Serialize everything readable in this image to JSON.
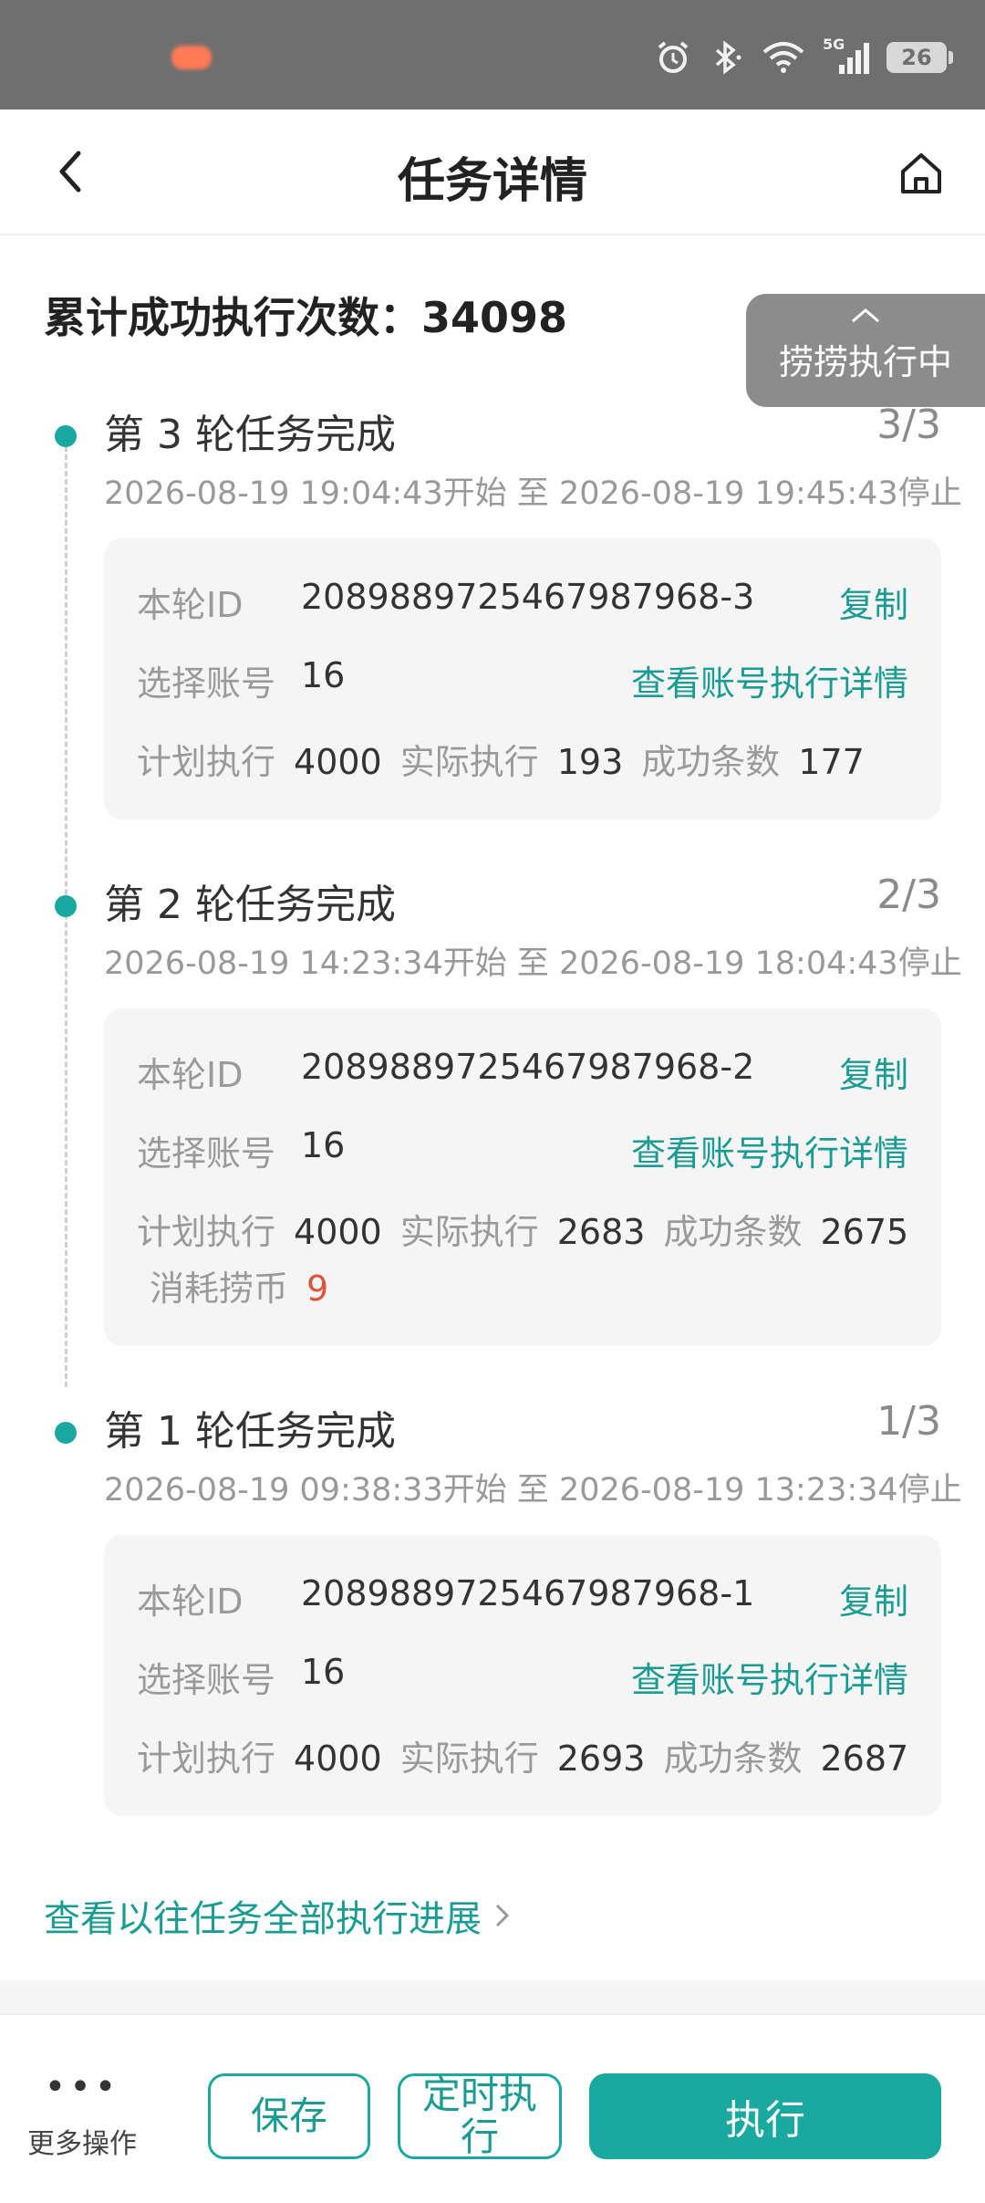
{
  "status_bar": {
    "network": "5G",
    "battery": "26",
    "icons": [
      "alarm-icon",
      "bluetooth-icon",
      "wifi-icon",
      "signal-icon",
      "battery-icon"
    ]
  },
  "header": {
    "title": "任务详情",
    "icons": [
      "back-arrow-icon",
      "home-icon"
    ]
  },
  "summary": {
    "text": "累计成功执行次数：34098"
  },
  "float_tag": {
    "text": "捞捞执行中"
  },
  "labels": {
    "round_id": "本轮ID",
    "account": "选择账号",
    "copy": "复制",
    "account_detail": "查看账号执行详情",
    "planned": "计划执行",
    "actual": "实际执行",
    "success": "成功条数",
    "cost": "消耗捞币"
  },
  "rounds": [
    {
      "title": "第 3 轮任务完成",
      "progress": "3/3",
      "time": "2026-08-19 19:04:43开始 至 2026-08-19 19:45:43停止",
      "round_id": "2089889725467987968-3",
      "account": "16",
      "planned": "4000",
      "actual": "193",
      "success": "177"
    },
    {
      "title": "第 2 轮任务完成",
      "progress": "2/3",
      "time": "2026-08-19 14:23:34开始 至 2026-08-19 18:04:43停止",
      "round_id": "2089889725467987968-2",
      "account": "16",
      "planned": "4000",
      "actual": "2683",
      "success": "2675",
      "cost": "9"
    },
    {
      "title": "第 1 轮任务完成",
      "progress": "1/3",
      "time": "2026-08-19 09:38:33开始 至 2026-08-19 13:23:34停止",
      "round_id": "2089889725467987968-1",
      "account": "16",
      "planned": "4000",
      "actual": "2693",
      "success": "2687"
    }
  ],
  "history_link": "查看以往任务全部执行进展",
  "footer": {
    "more_label": "更多操作",
    "save": "保存",
    "timer": "定时执行",
    "execute": "执行"
  },
  "colors": {
    "accent": "#1aa9a0",
    "link": "#1a9c95",
    "cost": "#e0533a",
    "status_bar": "#6f6f6f"
  }
}
